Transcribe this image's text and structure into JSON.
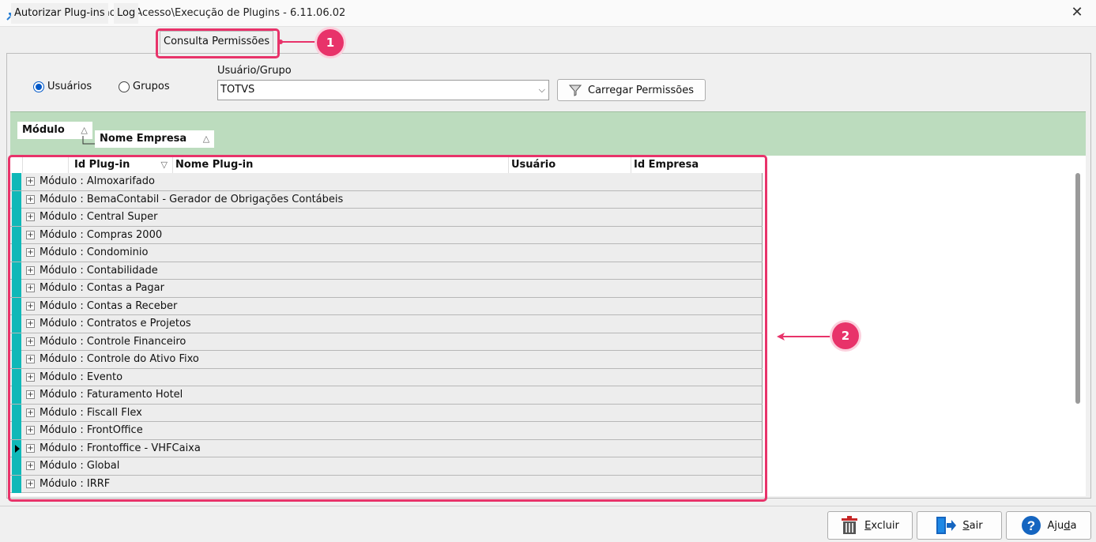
{
  "window": {
    "title": "263 - Autorização de Acesso\\Execução de Plugins - 6.11.06.02"
  },
  "tabs": [
    {
      "label": "Autorizar Plug-ins"
    },
    {
      "label": "Log"
    },
    {
      "label": "Consulta Permissões",
      "active": true
    }
  ],
  "filters": {
    "radio_users": "Usuários",
    "radio_groups": "Grupos",
    "selected": "Usuários",
    "user_group_label": "Usuário/Grupo",
    "user_group_value": "TOTVS",
    "load_button": "Carregar Permissões"
  },
  "grouping": {
    "level1": "Módulo",
    "level2": "Nome Empresa"
  },
  "grid": {
    "columns": [
      "Id Plug-in",
      "Nome Plug-in",
      "Usuário",
      "Id Empresa"
    ],
    "rows": [
      "Módulo : Almoxarifado",
      "Módulo : BemaContabil - Gerador de Obrigações Contábeis",
      "Módulo : Central Super",
      "Módulo : Compras 2000",
      "Módulo : Condominio",
      "Módulo : Contabilidade",
      "Módulo : Contas a Pagar",
      "Módulo : Contas a Receber",
      "Módulo : Contratos e Projetos",
      "Módulo : Controle Financeiro",
      "Módulo : Controle do Ativo Fixo",
      "Módulo : Evento",
      "Módulo : Faturamento Hotel",
      "Módulo : Fiscall Flex",
      "Módulo : FrontOffice",
      "Módulo : Frontoffice - VHFCaixa",
      "Módulo : Global",
      "Módulo : IRRF"
    ],
    "current_row": 15
  },
  "annotations": {
    "badge1": "1",
    "badge2": "2"
  },
  "footer": {
    "delete_prefix": "E",
    "delete_rest": "xcluir",
    "exit_prefix": "S",
    "exit_rest": "air",
    "help_prefix": "Aju",
    "help_u": "d",
    "help_rest": "a"
  },
  "colors": {
    "accent_pink": "#e8336a",
    "group_green": "#bcdcbe",
    "row_indicator": "#10b8b8"
  }
}
